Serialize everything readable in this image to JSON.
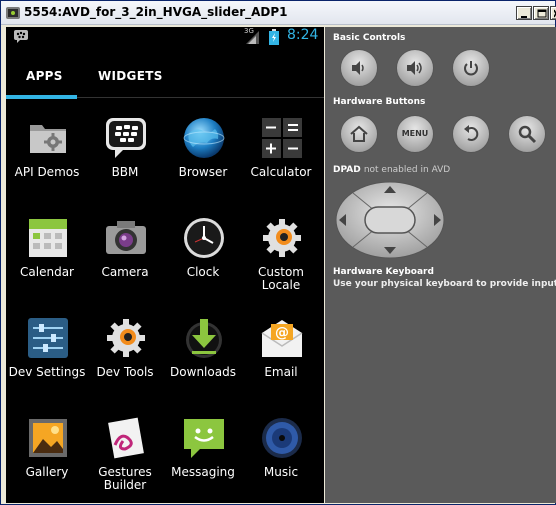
{
  "window": {
    "title": "5554:AVD_for_3_2in_HVGA_slider_ADP1"
  },
  "statusbar": {
    "network": "3G",
    "time": "8:24"
  },
  "tabs": [
    {
      "label": "APPS",
      "selected": true
    },
    {
      "label": "WIDGETS",
      "selected": false
    }
  ],
  "apps": [
    {
      "label": "API Demos",
      "icon": "folder-gear-icon"
    },
    {
      "label": "BBM",
      "icon": "bbm-icon"
    },
    {
      "label": "Browser",
      "icon": "globe-icon"
    },
    {
      "label": "Calculator",
      "icon": "calculator-icon"
    },
    {
      "label": "Calendar",
      "icon": "calendar-icon"
    },
    {
      "label": "Camera",
      "icon": "camera-icon"
    },
    {
      "label": "Clock",
      "icon": "clock-icon"
    },
    {
      "label": "Custom Locale",
      "icon": "gear-icon"
    },
    {
      "label": "Dev Settings",
      "icon": "settings-sliders-icon"
    },
    {
      "label": "Dev Tools",
      "icon": "gear-icon"
    },
    {
      "label": "Downloads",
      "icon": "download-icon"
    },
    {
      "label": "Email",
      "icon": "email-icon"
    },
    {
      "label": "Gallery",
      "icon": "gallery-icon"
    },
    {
      "label": "Gestures Builder",
      "icon": "gestures-icon"
    },
    {
      "label": "Messaging",
      "icon": "messaging-icon"
    },
    {
      "label": "Music",
      "icon": "music-icon"
    }
  ],
  "controls": {
    "basic_title": "Basic Controls",
    "hardware_title": "Hardware Buttons",
    "menu_label": "MENU",
    "dpad_title": "DPAD",
    "dpad_note": "not enabled in AVD",
    "keyboard_title": "Hardware Keyboard",
    "keyboard_note": "Use your physical keyboard to provide input"
  },
  "colors": {
    "accent": "#33b5e5",
    "panel": "#5a5a5a",
    "screen": "#000000"
  }
}
